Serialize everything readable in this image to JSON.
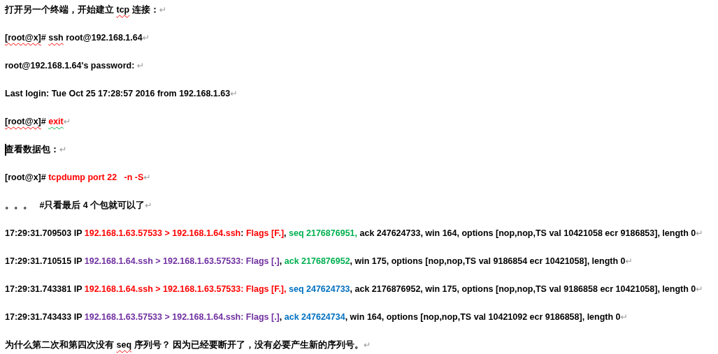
{
  "paragraphs": [
    {
      "mark": "↵",
      "segments": [
        {
          "text": "打开另一个终端，开始建立 "
        },
        {
          "text": "tcp",
          "spelling_error": true
        },
        {
          "text": " 连接："
        }
      ]
    },
    {
      "mark": "↵",
      "segments": [
        {
          "text": "[root@x]",
          "spelling_error": true
        },
        {
          "text": "# "
        },
        {
          "text": "ssh",
          "spelling_error": true
        },
        {
          "text": " root@192.168.1.64"
        }
      ]
    },
    {
      "mark": "↵",
      "segments": [
        {
          "text": "root@192.168.1.64's password: "
        }
      ]
    },
    {
      "mark": "↵",
      "segments": [
        {
          "text": "Last login: Tue Oct 25 17:28:57 2016 from 192.168.1.63"
        }
      ]
    },
    {
      "mark": "↵",
      "segments": [
        {
          "text": "[root@x]",
          "spelling_error": true
        },
        {
          "text": "# "
        },
        {
          "text": "exit",
          "color": "#ff0000",
          "grammar_error": true
        }
      ]
    },
    {
      "mark": "↵",
      "cursor": true,
      "segments": [
        {
          "text": "查看数据包："
        }
      ]
    },
    {
      "mark": "↵",
      "segments": [
        {
          "text": "[root@x]# "
        },
        {
          "text": "tcpdump port 22   -n -S",
          "color": "#ff0000"
        }
      ]
    },
    {
      "mark": "↵",
      "segments": [
        {
          "text": "。。。   #只看最后 4 个包就可以了"
        }
      ]
    },
    {
      "mark": "↵",
      "segments": [
        {
          "text": "17:29:31.709503 IP "
        },
        {
          "text": "192.168.1.63.57533 > 192.168.1.64.ssh",
          "color": "#ff0000"
        },
        {
          "text": ": "
        },
        {
          "text": "Flags [F.]",
          "color": "#ff0000"
        },
        {
          "text": ", "
        },
        {
          "text": "seq 2176876951,",
          "color": "#00b050"
        },
        {
          "text": " ack 247624733, win 164, options [nop,nop,TS val 10421058 ecr 9186853], length 0"
        }
      ]
    },
    {
      "mark": "↵",
      "segments": [
        {
          "text": "17:29:31.710515 IP "
        },
        {
          "text": "192.168.1.64.ssh > 192.168.1.63.57533: Flags [.]",
          "color": "#7030a0"
        },
        {
          "text": ", "
        },
        {
          "text": "ack 2176876952",
          "color": "#00b050"
        },
        {
          "text": ", win 175, options [nop,nop,TS val 9186854 ecr 10421058], length 0"
        }
      ]
    },
    {
      "mark": "↵",
      "segments": [
        {
          "text": "17:29:31.743381 IP "
        },
        {
          "text": "192.168.1.64.ssh > 192.168.1.63.57533: Flags [F.], ",
          "color": "#ff0000"
        },
        {
          "text": "seq 247624733",
          "color": "#0070c0"
        },
        {
          "text": ", ack 2176876952, win 175, options [nop,nop,TS val 9186858 ecr 10421058], length 0"
        }
      ]
    },
    {
      "mark": "↵",
      "segments": [
        {
          "text": "17:29:31.743433 IP "
        },
        {
          "text": "192.168.1.63.57533 > 192.168.1.64.ssh: Flags [.]",
          "color": "#7030a0"
        },
        {
          "text": ", "
        },
        {
          "text": "ack 247624734",
          "color": "#0070c0"
        },
        {
          "text": ", win 164, options [nop,nop,TS val 10421092 ecr 9186858], length 0"
        }
      ]
    },
    {
      "mark": "↵",
      "segments": [
        {
          "text": "为什么第二次和第四次没有 "
        },
        {
          "text": "seq",
          "spelling_error": true
        },
        {
          "text": " 序列号？ 因为已经要断开了，没有必要产生新的序列号。"
        }
      ]
    }
  ]
}
